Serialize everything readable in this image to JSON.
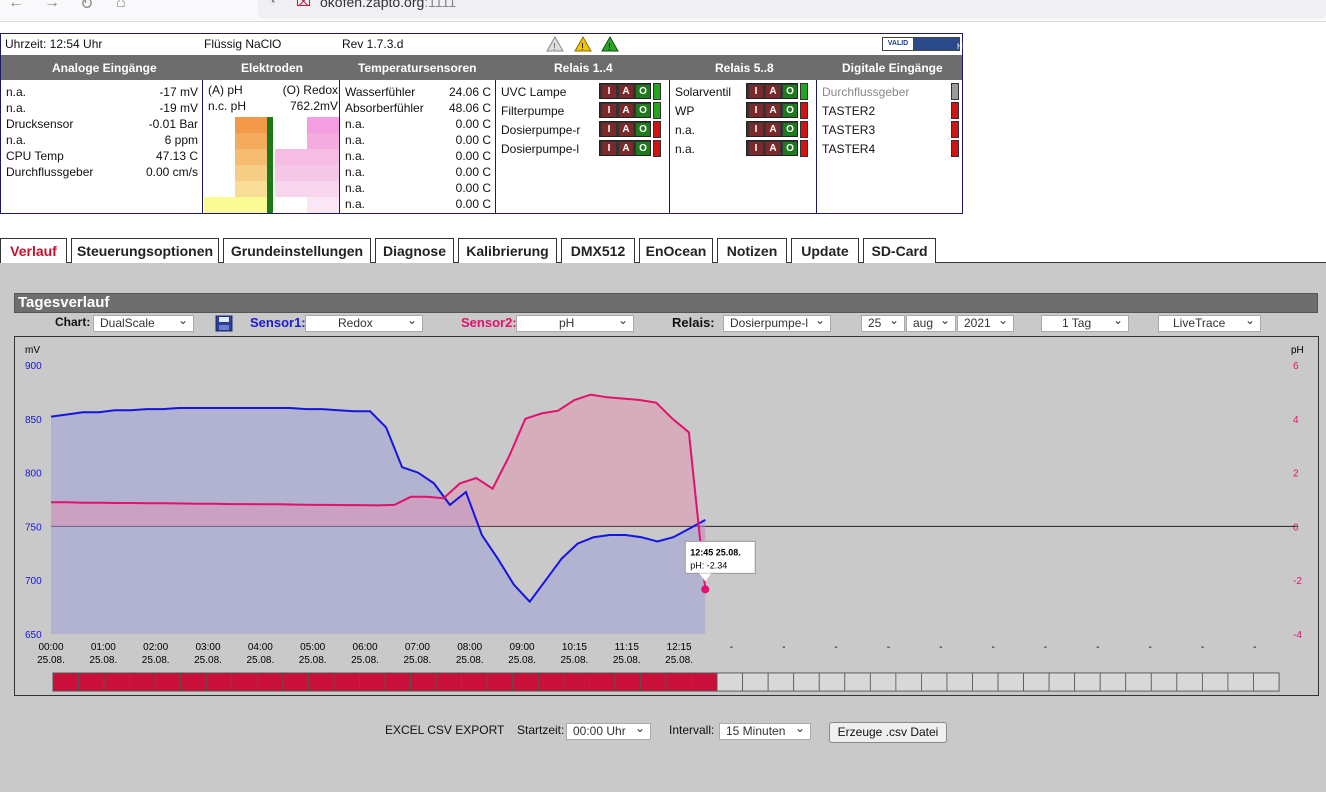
{
  "browser": {
    "url": "okofen.zapto.org",
    "port": ":1111"
  },
  "status": {
    "time": "Uhrzeit: 12:54 Uhr",
    "medium": "Flüssig NaClO",
    "revision": "Rev 1.7.3.d",
    "badge": "HTML 4.01"
  },
  "headers": [
    "Analoge Eingänge",
    "Elektroden",
    "Temperatursensoren",
    "Relais 1..4",
    "Relais 5..8",
    "Digitale Eingänge"
  ],
  "analog": [
    {
      "label": "n.a.",
      "value": "-17 mV"
    },
    {
      "label": "n.a.",
      "value": "-19 mV"
    },
    {
      "label": "Drucksensor",
      "value": "-0.01 Bar"
    },
    {
      "label": "n.a.",
      "value": "6 ppm"
    },
    {
      "label": "CPU Temp",
      "value": "47.13 C"
    },
    {
      "label": "Durchflussgeber",
      "value": "0.00 cm/s"
    }
  ],
  "electrodes": {
    "label_a": "(A) pH",
    "label_o": "(O) Redox",
    "sub_a": "n.c. pH",
    "value_o": "762.2mV"
  },
  "temps": [
    {
      "label": "Wasserfühler",
      "value": "24.06 C"
    },
    {
      "label": "Absorberfühler",
      "value": "48.06 C"
    },
    {
      "label": "n.a.",
      "value": "0.00 C"
    },
    {
      "label": "n.a.",
      "value": "0.00 C"
    },
    {
      "label": "n.a.",
      "value": "0.00 C"
    },
    {
      "label": "n.a.",
      "value": "0.00 C"
    },
    {
      "label": "n.a.",
      "value": "0.00 C"
    },
    {
      "label": "n.a.",
      "value": "0.00 C"
    }
  ],
  "relais1": [
    {
      "label": "UVC Lampe",
      "state": "green"
    },
    {
      "label": "Filterpumpe",
      "state": "green"
    },
    {
      "label": "Dosierpumpe-r",
      "state": "red"
    },
    {
      "label": "Dosierpumpe-l",
      "state": "red"
    }
  ],
  "relais2": [
    {
      "label": "Solarventil",
      "state": "green"
    },
    {
      "label": "WP",
      "state": "red"
    },
    {
      "label": "n.a.",
      "state": "red"
    },
    {
      "label": "n.a.",
      "state": "red"
    }
  ],
  "iao": {
    "i": "I",
    "a": "A",
    "o": "O"
  },
  "digital": [
    {
      "label": "Durchflussgeber",
      "state": "grey"
    },
    {
      "label": "TASTER2",
      "state": "red"
    },
    {
      "label": "TASTER3",
      "state": "red"
    },
    {
      "label": "TASTER4",
      "state": "red"
    }
  ],
  "tabs": [
    "Verlauf",
    "Steuerungsoptionen",
    "Grundeinstellungen",
    "Diagnose",
    "Kalibrierung",
    "DMX512",
    "EnOcean",
    "Notizen",
    "Update",
    "SD-Card"
  ],
  "tagesverlauf": {
    "title": "Tagesverlauf",
    "chart_label": "Chart:",
    "chart_value": "DualScale",
    "sensor1_label": "Sensor1:",
    "sensor1_value": "Redox",
    "sensor2_label": "Sensor2:",
    "sensor2_value": "pH",
    "relais_label": "Relais:",
    "relais_value": "Dosierpumpe-l",
    "day": "25",
    "month": "aug",
    "year": "2021",
    "range": "1 Tag",
    "mode": "LiveTrace"
  },
  "colors": {
    "redox": "#1515e0",
    "ph": "#e0126e",
    "relay_on": "#c8103a"
  },
  "chart_data": {
    "type": "line",
    "y1_label": "mV",
    "y2_label": "pH",
    "ylim_left": [
      650,
      900
    ],
    "ylim_right": [
      -4,
      6
    ],
    "yticks_left": [
      "900",
      "850",
      "800",
      "750",
      "700",
      "650"
    ],
    "yticks_right": [
      "6",
      "4",
      "2",
      "0",
      "-2",
      "-4"
    ],
    "xticks": [
      {
        "t": "00:00",
        "d": "25.08."
      },
      {
        "t": "01:00",
        "d": "25.08."
      },
      {
        "t": "02:00",
        "d": "25.08."
      },
      {
        "t": "03:00",
        "d": "25.08."
      },
      {
        "t": "04:00",
        "d": "25.08."
      },
      {
        "t": "05:00",
        "d": "25.08."
      },
      {
        "t": "06:00",
        "d": "25.08."
      },
      {
        "t": "07:00",
        "d": "25.08."
      },
      {
        "t": "08:00",
        "d": "25.08."
      },
      {
        "t": "09:00",
        "d": "25.08."
      },
      {
        "t": "10:15",
        "d": "25.08."
      },
      {
        "t": "11:15",
        "d": "25.08."
      },
      {
        "t": "12:15",
        "d": "25.08."
      },
      {
        "t": "-",
        "d": ""
      },
      {
        "t": "-",
        "d": ""
      },
      {
        "t": "-",
        "d": ""
      },
      {
        "t": "-",
        "d": ""
      },
      {
        "t": "-",
        "d": ""
      },
      {
        "t": "-",
        "d": ""
      },
      {
        "t": "-",
        "d": ""
      },
      {
        "t": "-",
        "d": ""
      },
      {
        "t": "-",
        "d": ""
      },
      {
        "t": "-",
        "d": ""
      },
      {
        "t": "-",
        "d": ""
      }
    ],
    "series": [
      {
        "name": "Redox",
        "axis": "left",
        "values": [
          852,
          854,
          856,
          856,
          858,
          858,
          859,
          859,
          860,
          860,
          860,
          860,
          860,
          860,
          860,
          860,
          859,
          859,
          858,
          857,
          857,
          842,
          805,
          800,
          790,
          770,
          782,
          742,
          720,
          696,
          680,
          700,
          720,
          734,
          740,
          742,
          742,
          740,
          736,
          740,
          748,
          756
        ]
      },
      {
        "name": "pH",
        "axis": "right",
        "values": [
          0.9,
          0.9,
          0.88,
          0.88,
          0.87,
          0.87,
          0.86,
          0.86,
          0.85,
          0.84,
          0.84,
          0.83,
          0.83,
          0.82,
          0.82,
          0.81,
          0.8,
          0.8,
          0.79,
          0.79,
          0.78,
          0.8,
          1.1,
          1.1,
          1.05,
          1.6,
          1.8,
          1.4,
          2.6,
          4.0,
          4.2,
          4.3,
          4.7,
          4.9,
          4.8,
          4.75,
          4.7,
          4.6,
          4.0,
          3.5,
          -2.34
        ]
      }
    ],
    "tooltip": {
      "time": "12:45 25.08.",
      "label": "pH:",
      "value": "-2.34"
    },
    "relay_segments_total": 48,
    "relay_segments_on": 26
  },
  "csv": {
    "label": "EXCEL CSV EXPORT",
    "start_label": "Startzeit:",
    "start_value": "00:00 Uhr",
    "interval_label": "Intervall:",
    "interval_value": "15 Minuten",
    "button": "Erzeuge .csv Datei"
  }
}
